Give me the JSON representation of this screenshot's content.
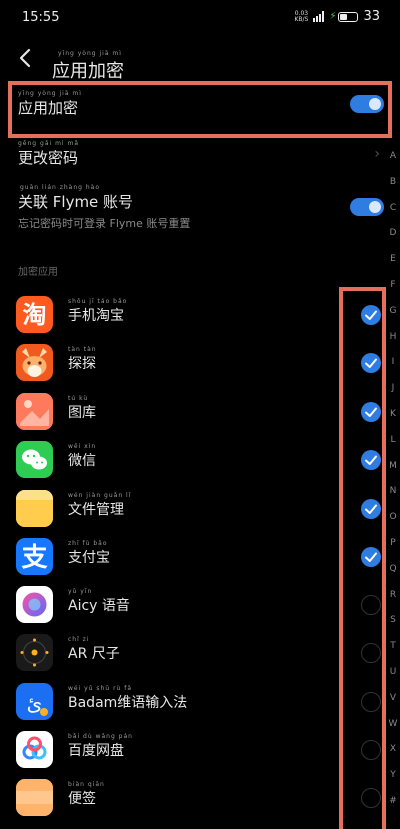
{
  "status_bar": {
    "time": "15:55",
    "net_speed_value": "0.03",
    "net_speed_unit": "KB/S",
    "battery": "33"
  },
  "header": {
    "title": "应用加密",
    "title_pinyin": "yīng yòng jiā mì"
  },
  "settings": {
    "app_lock": {
      "label": "应用加密",
      "pinyin": "yīng yòng jiā mì",
      "enabled": true
    },
    "change_password": {
      "label": "更改密码",
      "pinyin": "gēng gǎi mì mǎ"
    },
    "link_flyme": {
      "label": "关联 Flyme 账号",
      "pinyin": "guān lián zhàng hào",
      "description": "忘记密码时可登录 Flyme 账号重置",
      "enabled": true
    }
  },
  "section": {
    "title": "加密应用"
  },
  "apps": [
    {
      "name": "手机淘宝",
      "pinyin": "shǒu jī táo bǎo",
      "checked": true
    },
    {
      "name": "探探",
      "pinyin": "tàn tàn",
      "checked": true
    },
    {
      "name": "图库",
      "pinyin": "tú kù",
      "checked": true
    },
    {
      "name": "微信",
      "pinyin": "wēi xìn",
      "checked": true
    },
    {
      "name": "文件管理",
      "pinyin": "wén jiàn guǎn lǐ",
      "checked": true
    },
    {
      "name": "支付宝",
      "pinyin": "zhī fù bǎo",
      "checked": true
    },
    {
      "name": "Aicy 语音",
      "pinyin": "yǔ yīn",
      "checked": false
    },
    {
      "name": "AR 尺子",
      "pinyin": "chǐ zi",
      "checked": false
    },
    {
      "name": "Badam维语输入法",
      "pinyin": "wéi yǔ shū rù fǎ",
      "checked": false
    },
    {
      "name": "百度网盘",
      "pinyin": "bǎi dù wǎng pán",
      "checked": false
    },
    {
      "name": "便签",
      "pinyin": "biàn qiān",
      "checked": false
    }
  ],
  "alphabet": [
    "A",
    "B",
    "C",
    "D",
    "E",
    "F",
    "G",
    "H",
    "I",
    "J",
    "K",
    "L",
    "M",
    "N",
    "O",
    "P",
    "Q",
    "R",
    "S",
    "T",
    "U",
    "V",
    "W",
    "X",
    "Y",
    "#"
  ],
  "colors": {
    "accent": "#2f7de1",
    "highlight_outline": "#e56f5d",
    "background": "#000000"
  }
}
